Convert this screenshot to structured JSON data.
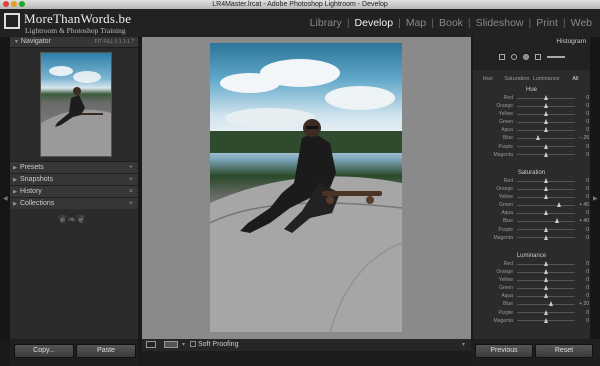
{
  "window_title": "LR4Master.lrcat - Adobe Photoshop Lightroom - Develop",
  "logo": {
    "title": "MoreThanWords.be",
    "subtitle": "Lightroom & Photoshop Training"
  },
  "modules": [
    {
      "label": "Library",
      "active": false
    },
    {
      "label": "Develop",
      "active": true
    },
    {
      "label": "Map",
      "active": false
    },
    {
      "label": "Book",
      "active": false
    },
    {
      "label": "Slideshow",
      "active": false
    },
    {
      "label": "Print",
      "active": false
    },
    {
      "label": "Web",
      "active": false
    }
  ],
  "navigator": {
    "title": "Navigator",
    "zoom_options": "FIT  FILL  1:1  1:1  ?"
  },
  "left_sections": [
    "Presets",
    "Snapshots",
    "History",
    "Collections"
  ],
  "left_buttons": {
    "copy": "Copy...",
    "paste": "Paste"
  },
  "toolbar": {
    "soft_proofing": "Soft Proofing"
  },
  "histogram": {
    "label": "Histogram"
  },
  "hsl_tabs": [
    "Hue",
    "Saturation",
    "Luminance",
    "All"
  ],
  "hsl_groups": [
    {
      "title": "Hue",
      "rows": [
        {
          "label": "Red",
          "value": "0",
          "pos": 0.5
        },
        {
          "label": "Orange",
          "value": "0",
          "pos": 0.5
        },
        {
          "label": "Yellow",
          "value": "0",
          "pos": 0.5
        },
        {
          "label": "Green",
          "value": "0",
          "pos": 0.5
        },
        {
          "label": "Aqua",
          "value": "0",
          "pos": 0.5
        },
        {
          "label": "Blue",
          "value": "− 25",
          "pos": 0.375
        },
        {
          "label": "Purple",
          "value": "0",
          "pos": 0.5
        },
        {
          "label": "Magenta",
          "value": "0",
          "pos": 0.5
        }
      ]
    },
    {
      "title": "Saturation",
      "rows": [
        {
          "label": "Red",
          "value": "0",
          "pos": 0.5
        },
        {
          "label": "Orange",
          "value": "0",
          "pos": 0.5
        },
        {
          "label": "Yellow",
          "value": "0",
          "pos": 0.5
        },
        {
          "label": "Green",
          "value": "+ 45",
          "pos": 0.725
        },
        {
          "label": "Aqua",
          "value": "0",
          "pos": 0.5
        },
        {
          "label": "Blue",
          "value": "+ 40",
          "pos": 0.7
        },
        {
          "label": "Purple",
          "value": "0",
          "pos": 0.5
        },
        {
          "label": "Magenta",
          "value": "0",
          "pos": 0.5
        }
      ]
    },
    {
      "title": "Luminance",
      "rows": [
        {
          "label": "Red",
          "value": "0",
          "pos": 0.5
        },
        {
          "label": "Orange",
          "value": "0",
          "pos": 0.5
        },
        {
          "label": "Yellow",
          "value": "0",
          "pos": 0.5
        },
        {
          "label": "Green",
          "value": "0",
          "pos": 0.5
        },
        {
          "label": "Aqua",
          "value": "0",
          "pos": 0.5
        },
        {
          "label": "Blue",
          "value": "+ 20",
          "pos": 0.6
        },
        {
          "label": "Purple",
          "value": "0",
          "pos": 0.5
        },
        {
          "label": "Magenta",
          "value": "0",
          "pos": 0.5
        }
      ]
    }
  ],
  "right_buttons": {
    "previous": "Previous",
    "reset": "Reset"
  }
}
